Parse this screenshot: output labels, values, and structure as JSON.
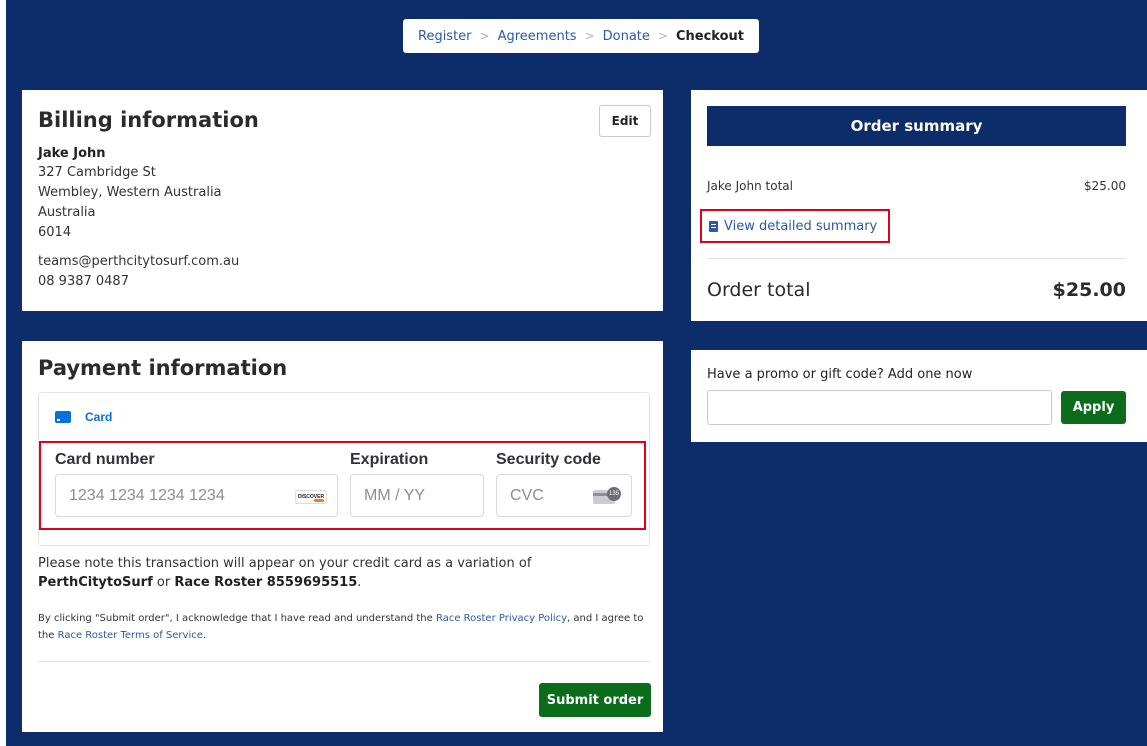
{
  "breadcrumb": {
    "steps": [
      "Register",
      "Agreements",
      "Donate"
    ],
    "separator": ">",
    "current": "Checkout"
  },
  "billing": {
    "title": "Billing information",
    "edit_label": "Edit",
    "name": "Jake John",
    "address": [
      "327 Cambridge St",
      "Wembley, Western Australia",
      "Australia",
      "6014"
    ],
    "email": "teams@perthcitytosurf.com.au",
    "phone": "08 9387 0487"
  },
  "payment": {
    "title": "Payment information",
    "method_tab": "Card",
    "card_number": {
      "label": "Card number",
      "placeholder": "1234 1234 1234 1234",
      "brand_badge": "DISCOVER"
    },
    "expiration": {
      "label": "Expiration",
      "placeholder": "MM / YY"
    },
    "security_code": {
      "label": "Security code",
      "placeholder": "CVC",
      "badge_number": "135"
    },
    "note": {
      "prefix": "Please note this transaction will appear on your credit card as a variation of ",
      "descriptor_1": "PerthCitytoSurf",
      "middle": " or ",
      "descriptor_2": "Race Roster 8559695515",
      "suffix": "."
    },
    "legal": {
      "part1": "By clicking \"Submit order\", I acknowledge that I have read and understand the ",
      "privacy_link": "Race Roster Privacy Policy",
      "part2": ", and I agree to the ",
      "terms_link": "Race Roster Terms of Service",
      "part3": "."
    },
    "submit_label": "Submit order"
  },
  "summary": {
    "title": "Order summary",
    "line_item_label": "Jake John total",
    "line_item_value": "$25.00",
    "view_detail_label": "View detailed summary",
    "order_total_label": "Order total",
    "order_total_value": "$25.00"
  },
  "promo": {
    "label": "Have a promo or gift code? Add one now",
    "input_value": "",
    "apply_label": "Apply"
  },
  "colors": {
    "background": "#0c2d69",
    "link": "#2a5aa8",
    "button_green": "#0b6d1c",
    "highlight_red": "#e0001b",
    "stripe_blue": "#0570de"
  }
}
